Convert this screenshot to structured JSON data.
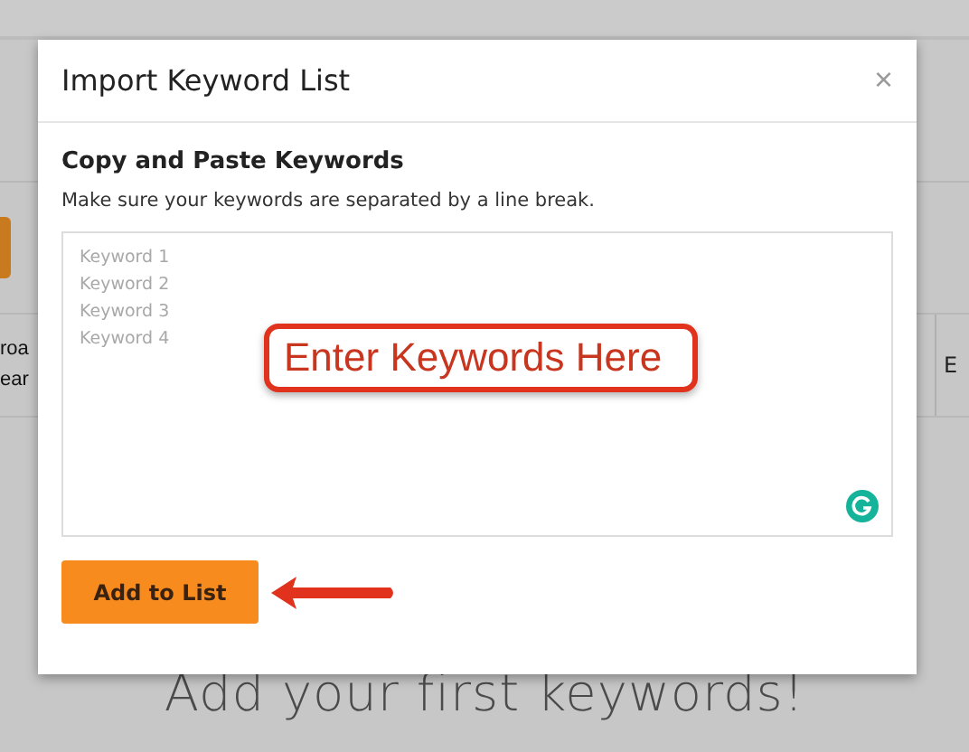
{
  "background": {
    "left_cell": [
      "roa",
      "ear"
    ],
    "right_cell": "E",
    "empty_message": "Add your first keywords!"
  },
  "dialog": {
    "title": "Import Keyword List",
    "close": "×",
    "heading": "Copy and Paste Keywords",
    "hint": "Make sure your keywords are separated by a line break.",
    "field": {
      "placeholder": "Keyword 1\nKeyword 2\nKeyword 3\nKeyword 4"
    },
    "callout": "Enter Keywords Here",
    "button": "Add to List"
  }
}
